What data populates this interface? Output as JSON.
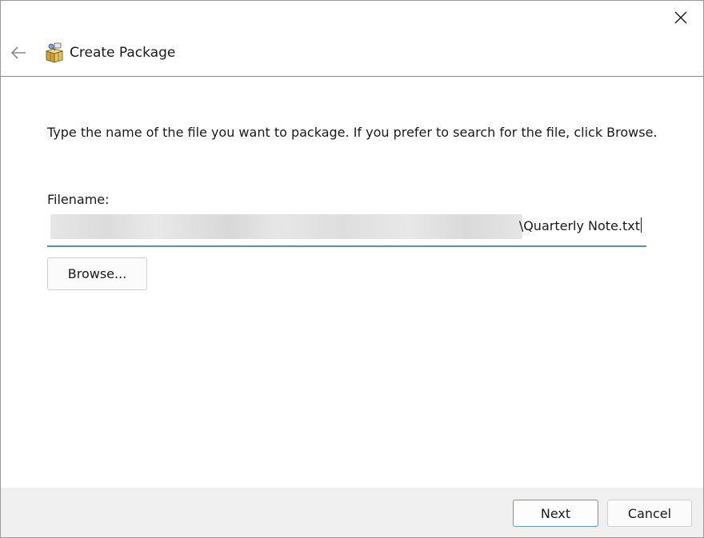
{
  "window": {
    "title": "Create Package"
  },
  "icons": {
    "close": "close-icon",
    "back": "back-arrow-icon",
    "app": "package-icon"
  },
  "main": {
    "instruction": "Type the name of the file you want to package. If you prefer to search for the file, click Browse.",
    "filename_label": "Filename:",
    "filename_value": "\\Quarterly Note.txt",
    "browse_label": "Browse..."
  },
  "footer": {
    "next_label": "Next",
    "cancel_label": "Cancel"
  },
  "colors": {
    "accent": "#5d9ac9",
    "input_underline": "#5b8fb0",
    "footer_bg": "#f0f0f0"
  }
}
